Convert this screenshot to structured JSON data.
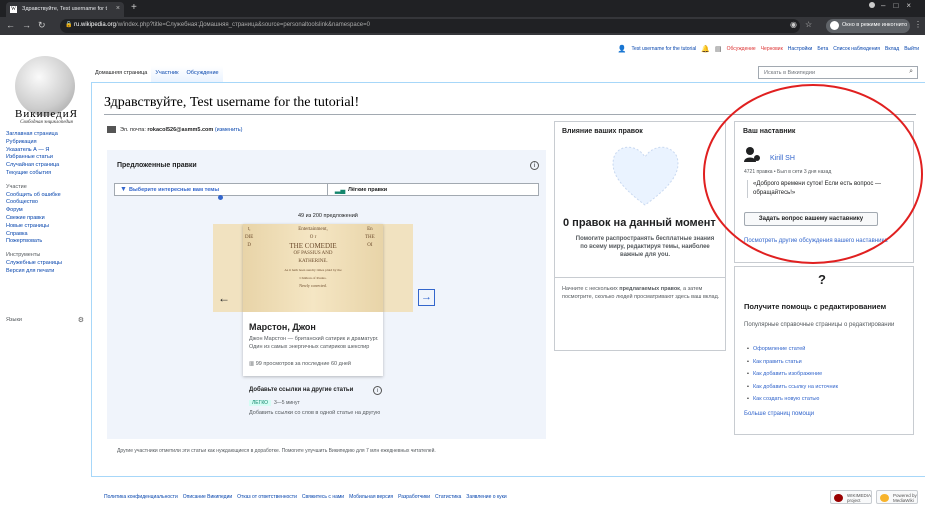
{
  "browser": {
    "tab_title": "Здравствуйте, Test username for t",
    "favicon": "W",
    "url_host": "ru.wikipedia.org",
    "url_path": "/w/index.php?title=Служебная:Домашняя_страница&source=personaltoolslink&namespace=0",
    "incognito_label": "Окно в режиме инкогнито"
  },
  "personal_tools": {
    "user": "Test username for the tutorial",
    "discussion": "Обсуждение",
    "drafts": "Черновик",
    "settings": "Настройки",
    "beta": "Бета",
    "watchlist": "Список наблюдения",
    "contributions": "Вклад",
    "logout": "Выйти"
  },
  "logo": {
    "title": "ВикипедиЯ",
    "subtitle": "Свободная энциклопедия"
  },
  "sidebar": {
    "nav": [
      "Заглавная страница",
      "Рубрикация",
      "Указатель А — Я",
      "Избранные статьи",
      "Случайная страница",
      "Текущие события"
    ],
    "participation_heading": "Участие",
    "participation": [
      "Сообщить об ошибке",
      "Сообщество",
      "Форум",
      "Свежие правки",
      "Новые страницы",
      "Справка",
      "Пожертвовать"
    ],
    "tools_heading": "Инструменты",
    "tools": [
      "Служебные страницы",
      "Версия для печати"
    ],
    "languages_heading": "Языки"
  },
  "tabs": {
    "home": "Домашняя страница",
    "user": "Участник",
    "discussion": "Обсуждение"
  },
  "search": {
    "placeholder": "Искать в Википедии"
  },
  "page": {
    "title": "Здравствуйте, Test username for the tutorial!",
    "email_label": "Эл. почта:",
    "email_value": "rokacol526@asmm5.com",
    "email_change": "(изменить)"
  },
  "suggested": {
    "title": "Предложенные правки",
    "filter_topics": "Выберите интересные вам темы",
    "filter_easy": "Лёгкие правки",
    "count": "49 из 200 предложений",
    "card_title": "Марстон, Джон",
    "card_desc": "Джон Марстон — британский сатирик и драматург. Один из самых энергичных сатириков шекспир",
    "card_views": "99 просмотров за последние 60 дней",
    "task_title": "Добавьте ссылки на другие статьи",
    "task_level": "ЛЕГКО",
    "task_time": "3—5 минут",
    "task_desc": "Добавить ссылки со слов в одной статье на другую",
    "footnote": "Другие участники отметили эти статьи как нуждающиеся в доработке. Помогите улучшить Википедию для 7 млн ежедневных читателей.",
    "book_center": [
      "Entertainment,",
      "O r",
      "THE COMEDIE",
      "OF PASSIUS AND",
      "KATHERINE.",
      "As it hath been sundry times plaid by the",
      "Children of Paules.",
      "Newly corrected."
    ],
    "book_left": [
      "t,",
      "DIE",
      "D"
    ],
    "book_right": [
      "En",
      "THE",
      "OI"
    ]
  },
  "impact": {
    "title": "Влияние ваших правок",
    "number": "0 правок на данный момент",
    "subtitle": "Помогите распространять бесплатные знания по всему миру, редактируя темы, наиболее важные для you.",
    "text_before": "Начните с нескольких ",
    "text_bold": "предлагаемых правок",
    "text_after": ", а затем посмотрите, сколько людей просматривают здесь ваш вклад."
  },
  "mentor": {
    "title": "Ваш наставник",
    "name": "Kirill SH",
    "meta": "4721 правка • Был в сети 3 дня назад",
    "quote": "«Доброго времени суток! Если есть вопрос — обращайтесь!»",
    "button": "Задать вопрос вашему наставнику",
    "link": "Посмотреть другие обсуждения вашего наставника"
  },
  "help": {
    "icon": "?",
    "title": "Получите помощь с редактированием",
    "subtitle": "Популярные справочные страницы о редактировании",
    "links": [
      "Оформление статей",
      "Как править статьи",
      "Как добавить изображение",
      "Как добавить ссылку на источник",
      "Как создать новую статью"
    ],
    "more": "Больше страниц помощи"
  },
  "footer": {
    "links": [
      "Политика конфиденциальности",
      "Описание Википедии",
      "Отказ от ответственности",
      "Свяжитесь с нами",
      "Мобильная версия",
      "Разработчики",
      "Статистика",
      "Заявление о куки"
    ],
    "badge_wikimedia": "WIKIMEDIA project",
    "badge_mediawiki": "Powered by MediaWiki"
  },
  "colors": {
    "link": "#0645ad",
    "accent": "#36c",
    "annotation": "#e02020"
  }
}
